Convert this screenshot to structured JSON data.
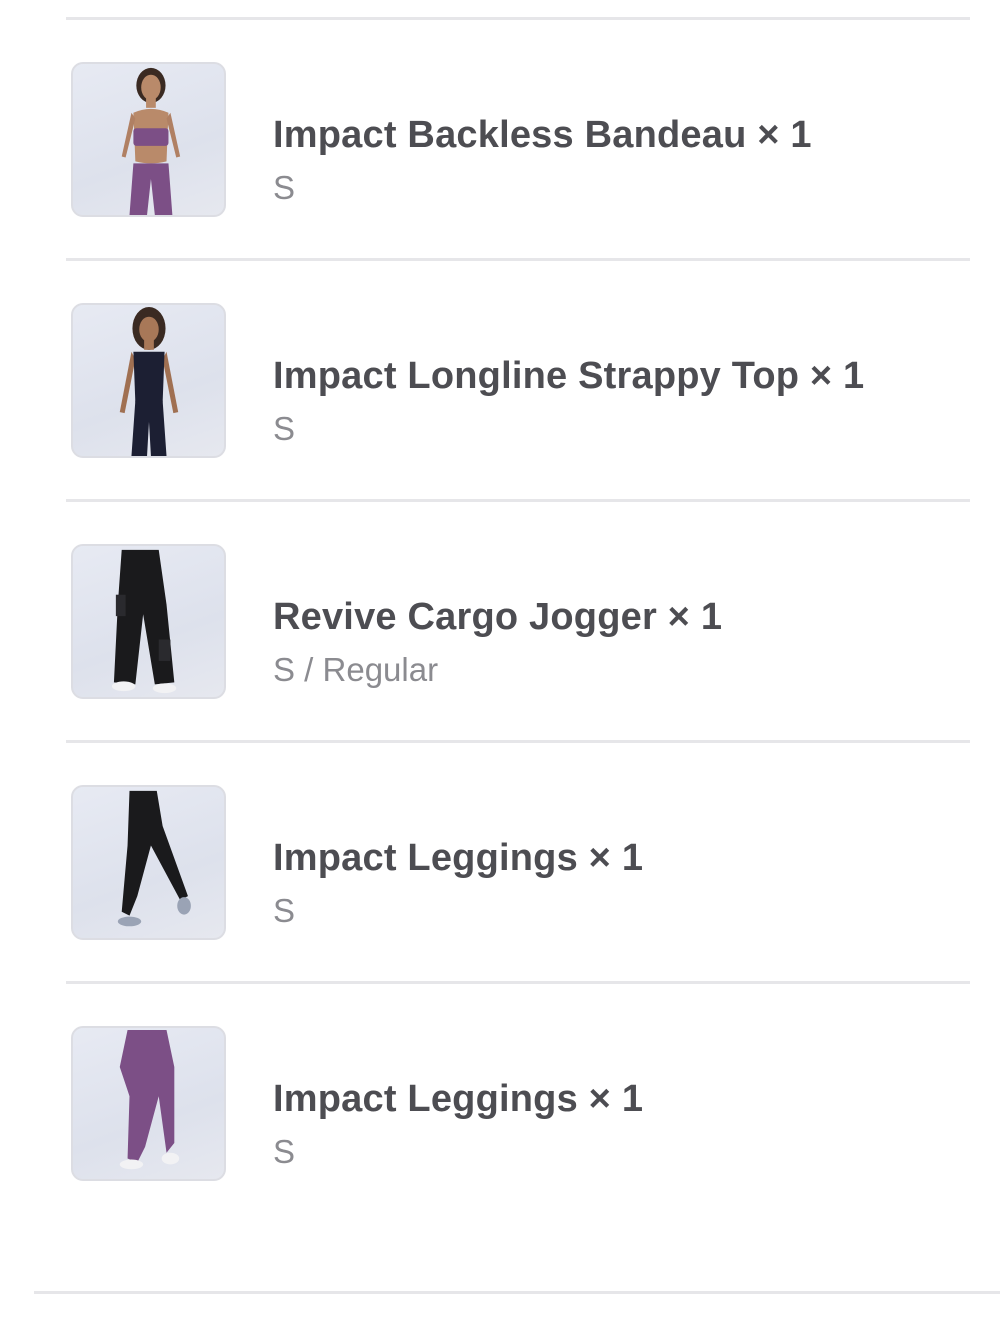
{
  "order_items": [
    {
      "title": "Impact Backless Bandeau × 1",
      "variant": "S",
      "image": "model-purple-bandeau-and-leggings"
    },
    {
      "title": "Impact Longline Strappy Top × 1",
      "variant": "S",
      "image": "model-navy-strappy-top-and-leggings"
    },
    {
      "title": "Revive Cargo Jogger × 1",
      "variant": "S / Regular",
      "image": "model-black-cargo-jogger"
    },
    {
      "title": "Impact Leggings × 1",
      "variant": "S",
      "image": "model-black-leggings"
    },
    {
      "title": "Impact Leggings × 1",
      "variant": "S",
      "image": "model-purple-leggings"
    }
  ],
  "colors": {
    "title_text": "#4d4d52",
    "variant_text": "#8b8b90",
    "divider": "#e6e6e9",
    "purple_fabric": "#7c4f86",
    "navy_fabric": "#1c1f33",
    "black_fabric": "#1a1a1c"
  }
}
